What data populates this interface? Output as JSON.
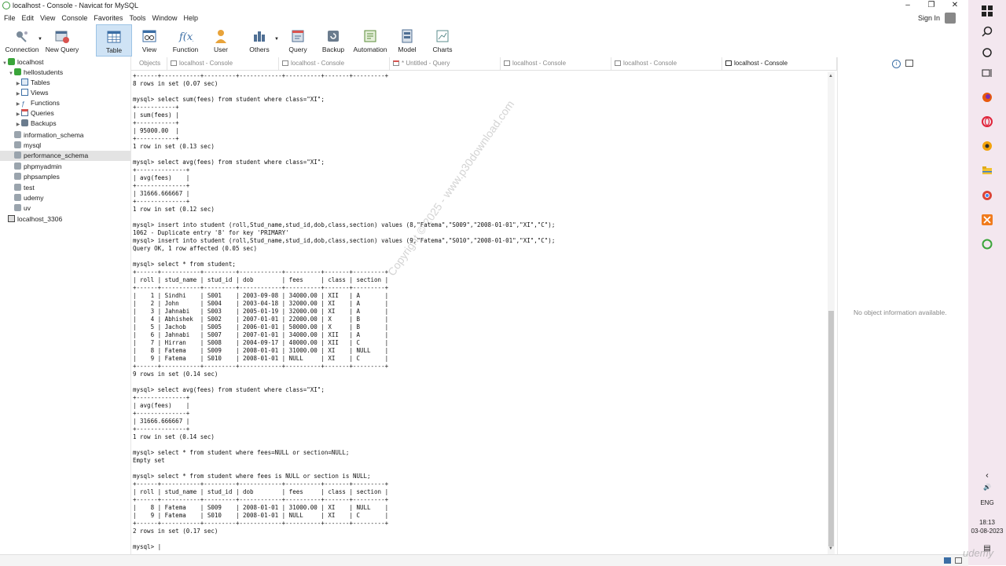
{
  "window": {
    "title": "localhost - Console - Navicat for MySQL"
  },
  "menu": [
    "File",
    "Edit",
    "View",
    "Console",
    "Favorites",
    "Tools",
    "Window",
    "Help"
  ],
  "account": {
    "signin_label": "Sign In"
  },
  "toolbar": [
    {
      "label": "Connection",
      "icon": "connection-icon",
      "has_dropdown": true
    },
    {
      "label": "New Query",
      "icon": "new-query-icon"
    },
    {
      "label": "Table",
      "icon": "table-icon",
      "active": true
    },
    {
      "label": "View",
      "icon": "view-icon"
    },
    {
      "label": "Function",
      "icon": "function-icon"
    },
    {
      "label": "User",
      "icon": "user-icon"
    },
    {
      "label": "Others",
      "icon": "others-icon",
      "has_dropdown": true
    },
    {
      "label": "Query",
      "icon": "query-icon"
    },
    {
      "label": "Backup",
      "icon": "backup-icon"
    },
    {
      "label": "Automation",
      "icon": "automation-icon"
    },
    {
      "label": "Model",
      "icon": "model-icon"
    },
    {
      "label": "Charts",
      "icon": "charts-icon"
    }
  ],
  "sidebar": {
    "items": [
      {
        "label": "localhost",
        "level": 0,
        "expanded": true,
        "icon": "connection-icon"
      },
      {
        "label": "hellostudents",
        "level": 1,
        "expanded": true,
        "icon": "database-icon"
      },
      {
        "label": "Tables",
        "level": 2,
        "icon": "table-icon"
      },
      {
        "label": "Views",
        "level": 2,
        "icon": "view-icon"
      },
      {
        "label": "Functions",
        "level": 2,
        "icon": "function-icon"
      },
      {
        "label": "Queries",
        "level": 2,
        "icon": "query-icon"
      },
      {
        "label": "Backups",
        "level": 2,
        "icon": "backup-icon"
      },
      {
        "label": "information_schema",
        "level": 1,
        "icon": "database-icon"
      },
      {
        "label": "mysql",
        "level": 1,
        "icon": "database-icon"
      },
      {
        "label": "performance_schema",
        "level": 1,
        "icon": "database-icon",
        "selected": true
      },
      {
        "label": "phpmyadmin",
        "level": 1,
        "icon": "database-icon"
      },
      {
        "label": "phpsamples",
        "level": 1,
        "icon": "database-icon"
      },
      {
        "label": "test",
        "level": 1,
        "icon": "database-icon"
      },
      {
        "label": "udemy",
        "level": 1,
        "icon": "database-icon"
      },
      {
        "label": "uv",
        "level": 1,
        "icon": "database-icon"
      },
      {
        "label": "localhost_3306",
        "level": 0,
        "icon": "connection-icon"
      }
    ]
  },
  "tabs": [
    {
      "label": "Objects"
    },
    {
      "label": "localhost - Console"
    },
    {
      "label": "localhost - Console"
    },
    {
      "label": "* Untitled - Query"
    },
    {
      "label": "localhost - Console"
    },
    {
      "label": "localhost - Console"
    },
    {
      "label": "localhost - Console",
      "active": true
    }
  ],
  "console": {
    "text": "+------+-----------+---------+------------+----------+-------+---------+\n8 rows in set (0.07 sec)\n\nmysql> select sum(fees) from student where class=\"XI\";\n+-----------+\n| sum(fees) |\n+-----------+\n| 95000.00  |\n+-----------+\n1 row in set (0.13 sec)\n\nmysql> select avg(fees) from student where class=\"XI\";\n+--------------+\n| avg(fees)    |\n+--------------+\n| 31666.666667 |\n+--------------+\n1 row in set (0.12 sec)\n\nmysql> insert into student (roll,Stud_name,stud_id,dob,class,section) values (8,\"Fatema\",\"S009\",\"2008-01-01\",\"XI\",\"C\");\n1062 - Duplicate entry '8' for key 'PRIMARY'\nmysql> insert into student (roll,Stud_name,stud_id,dob,class,section) values (9,\"Fatema\",\"S010\",\"2008-01-01\",\"XI\",\"C\");\nQuery OK, 1 row affected (0.05 sec)\n\nmysql> select * from student;\n+------+-----------+---------+------------+----------+-------+---------+\n| roll | stud_name | stud_id | dob        | fees     | class | section |\n+------+-----------+---------+------------+----------+-------+---------+\n|    1 | Sindhi    | S001    | 2003-09-08 | 34000.00 | XII   | A       |\n|    2 | John      | S004    | 2003-04-18 | 32000.00 | XI    | A       |\n|    3 | Jahnabi   | S003    | 2005-01-19 | 32000.00 | XI    | A       |\n|    4 | Abhishek  | S002    | 2007-01-01 | 22000.00 | X     | B       |\n|    5 | Jachob    | S005    | 2006-01-01 | 50000.00 | X     | B       |\n|    6 | Jahnabi   | S007    | 2007-01-01 | 34000.00 | XII   | A       |\n|    7 | Hirran    | S008    | 2004-09-17 | 40000.00 | XII   | C       |\n|    8 | Fatema    | S009    | 2008-01-01 | 31000.00 | XI    | NULL    |\n|    9 | Fatema    | S010    | 2008-01-01 | NULL     | XI    | C       |\n+------+-----------+---------+------------+----------+-------+---------+\n9 rows in set (0.14 sec)\n\nmysql> select avg(fees) from student where class=\"XI\";\n+--------------+\n| avg(fees)    |\n+--------------+\n| 31666.666667 |\n+--------------+\n1 row in set (0.14 sec)\n\nmysql> select * from student where fees=NULL or section=NULL;\nEmpty set\n\nmysql> select * from student where fees is NULL or section is NULL;\n+------+-----------+---------+------------+----------+-------+---------+\n| roll | stud_name | stud_id | dob        | fees     | class | section |\n+------+-----------+---------+------------+----------+-------+---------+\n|    8 | Fatema    | S009    | 2008-01-01 | 31000.00 | XI    | NULL    |\n|    9 | Fatema    | S010    | 2008-01-01 | NULL     | XI    | C       |\n+------+-----------+---------+------------+----------+-------+---------+\n2 rows in set (0.17 sec)\n\nmysql> |"
  },
  "info_panel": {
    "message": "No object information available."
  },
  "watermark": {
    "text": "Copyright © 2025 - www.p30download.com"
  },
  "taskbar": {
    "language": "ENG",
    "time": "18:13",
    "date": "03-08-2023"
  },
  "overlay_brand": "udemy",
  "colors": {
    "accent": "#cfe3f5",
    "taskbar": "#f3e7ef",
    "selection": "#e3e3e3"
  }
}
